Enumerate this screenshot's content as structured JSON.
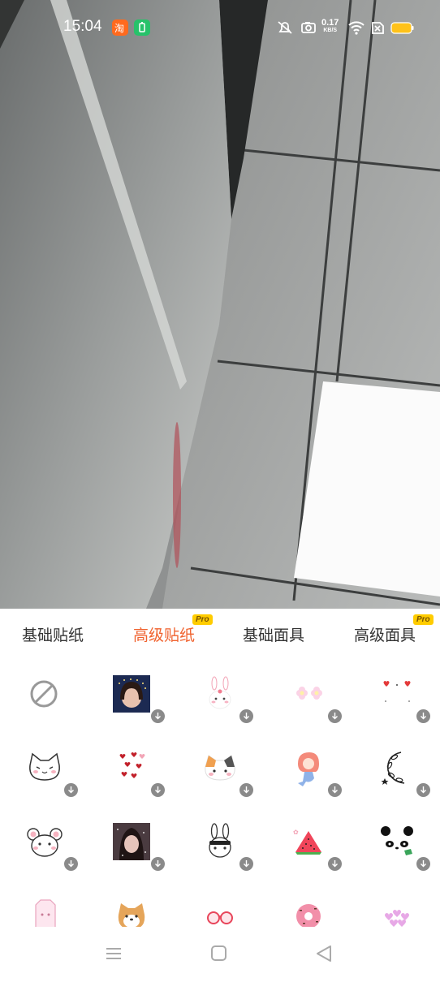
{
  "status_bar": {
    "time": "15:04",
    "net_speed_value": "0.17",
    "net_speed_unit": "KB/S"
  },
  "tabs": [
    {
      "label": "基础贴纸",
      "active": false,
      "pro": false
    },
    {
      "label": "高级贴纸",
      "active": true,
      "pro": true
    },
    {
      "label": "基础面具",
      "active": false,
      "pro": false
    },
    {
      "label": "高级面具",
      "active": false,
      "pro": true
    }
  ],
  "pro_badge": "Pro",
  "stickers": [
    {
      "name": "none-icon",
      "download": false
    },
    {
      "name": "starry-girl-photo",
      "download": true
    },
    {
      "name": "bunny-face-sticker",
      "download": true
    },
    {
      "name": "pink-flowers-sticker",
      "download": true
    },
    {
      "name": "red-hearts-sticker",
      "download": true
    },
    {
      "name": "white-cat-sticker",
      "download": true
    },
    {
      "name": "scattered-hearts-sticker",
      "download": true
    },
    {
      "name": "calico-cat-sticker",
      "download": true
    },
    {
      "name": "mermaid-girl-sticker",
      "download": true
    },
    {
      "name": "floral-wreath-sticker",
      "download": true
    },
    {
      "name": "white-mouse-sticker",
      "download": true
    },
    {
      "name": "girl-portrait-photo",
      "download": true
    },
    {
      "name": "black-white-bunny-sticker",
      "download": true
    },
    {
      "name": "watermelon-slice-sticker",
      "download": true
    },
    {
      "name": "panda-face-sticker",
      "download": true
    },
    {
      "name": "milk-carton-sticker",
      "download": false
    },
    {
      "name": "shiba-dog-sticker",
      "download": false
    },
    {
      "name": "red-glasses-sticker",
      "download": false
    },
    {
      "name": "donut-sticker",
      "download": false
    },
    {
      "name": "pink-hearts-cloud-sticker",
      "download": false
    }
  ],
  "colors": {
    "accent": "#f0622e",
    "pro_badge": "#ffcc00",
    "download_badge": "#8a8a8a"
  }
}
